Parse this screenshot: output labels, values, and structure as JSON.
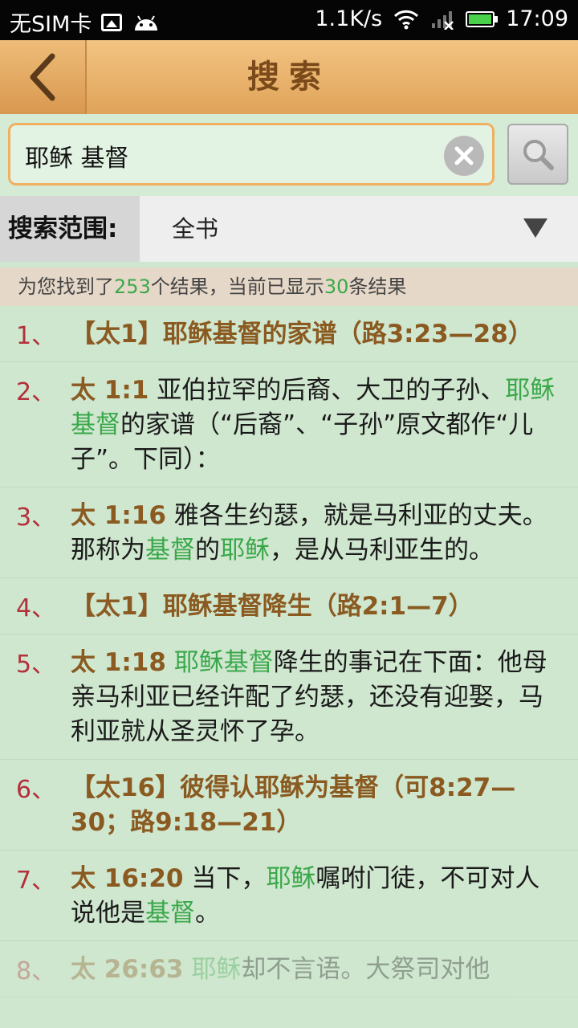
{
  "status_bar": {
    "carrier": "无SIM卡",
    "speed": "1.1K/s",
    "time": "17:09"
  },
  "title_bar": {
    "title": "搜索",
    "back_icon": "chevron-left-icon"
  },
  "search": {
    "value": "耶稣 基督",
    "clear_icon": "close-icon",
    "search_icon": "magnifier-icon"
  },
  "scope": {
    "label": "搜索范围:",
    "value": "全书"
  },
  "summary": {
    "prefix": "为您找到了",
    "total": "253",
    "middle": "个结果，当前已显示",
    "shown": "30",
    "suffix": "条结果"
  },
  "colors": {
    "accent_orange": "#e0a35a",
    "highlight_green": "#3aa84a",
    "heading_brown": "#8a5a20",
    "number_red": "#b4303a",
    "background": "#cfe6cf"
  },
  "results": [
    {
      "num": "1、",
      "heading": "【太1】耶稣基督的家谱（路3:23—28）"
    },
    {
      "num": "2、",
      "ref": "太 1:1",
      "t1": " 亚伯拉罕的后裔、大卫的子孙、",
      "h1": "耶稣基督",
      "t2": "的家谱（“后裔”、“子孙”原文都作“儿子”。下同）："
    },
    {
      "num": "3、",
      "ref": "太 1:16",
      "t1": " 雅各生约瑟，就是马利亚的丈夫。那称为",
      "h1": "基督",
      "t2": "的",
      "h2": "耶稣",
      "t3": "，是从马利亚生的。"
    },
    {
      "num": "4、",
      "heading": "【太1】耶稣基督降生（路2:1—7）"
    },
    {
      "num": "5、",
      "ref": "太 1:18",
      "h1": " 耶稣基督",
      "t1": "降生的事记在下面：他母亲马利亚已经许配了约瑟，还没有迎娶，马利亚就从圣灵怀了孕。"
    },
    {
      "num": "6、",
      "heading": "【太16】彼得认耶稣为基督（可8:27—30；路9:18—21）"
    },
    {
      "num": "7、",
      "ref": "太 16:20",
      "t1": " 当下，",
      "h1": "耶稣",
      "t2": "嘱咐门徒，不可对人说他是",
      "h2": "基督",
      "t3": "。"
    },
    {
      "num": "8、",
      "ref": "太 26:63",
      "h1": " 耶稣",
      "t1": "却不言语。大祭司对他"
    }
  ]
}
